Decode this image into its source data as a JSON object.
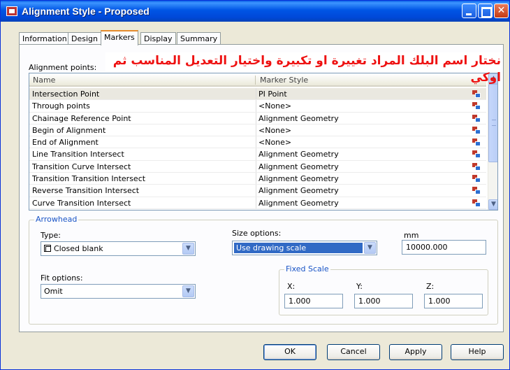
{
  "window": {
    "title": "Alignment Style - Proposed"
  },
  "tabs": [
    "Information",
    "Design",
    "Markers",
    "Display",
    "Summary"
  ],
  "active_tab": "Markers",
  "annotation_text": "نختار اسم البلك المراد تغييرة او تكبيرة واختيار التعديل المناسب ثم اوكي",
  "alignment_points": {
    "label": "Alignment points:",
    "columns": [
      "Name",
      "Marker Style"
    ],
    "rows": [
      {
        "name": "Intersection Point",
        "style": "PI Point"
      },
      {
        "name": "Through points",
        "style": "<None>"
      },
      {
        "name": "Chainage Reference Point",
        "style": "Alignment Geometry"
      },
      {
        "name": "Begin of Alignment",
        "style": "<None>"
      },
      {
        "name": "End of Alignment",
        "style": "<None>"
      },
      {
        "name": "Line Transition Intersect",
        "style": "Alignment Geometry"
      },
      {
        "name": "Transition Curve Intersect",
        "style": "Alignment Geometry"
      },
      {
        "name": "Transition Transition Intersect",
        "style": "Alignment Geometry"
      },
      {
        "name": "Reverse Transition Intersect",
        "style": "Alignment Geometry"
      },
      {
        "name": "Curve Transition Intersect",
        "style": "Alignment Geometry"
      }
    ]
  },
  "arrowhead": {
    "legend": "Arrowhead",
    "type_label": "Type:",
    "type_value": "Closed blank",
    "fit_label": "Fit options:",
    "fit_value": "Omit",
    "size_label": "Size options:",
    "size_value": "Use drawing scale",
    "unit_label": "mm",
    "size_number": "10000.000",
    "fixed_scale": {
      "legend": "Fixed Scale",
      "x_label": "X:",
      "x_value": "1.000",
      "y_label": "Y:",
      "y_value": "1.000",
      "z_label": "Z:",
      "z_value": "1.000"
    }
  },
  "buttons": {
    "ok": "OK",
    "cancel": "Cancel",
    "apply": "Apply",
    "help": "Help"
  }
}
